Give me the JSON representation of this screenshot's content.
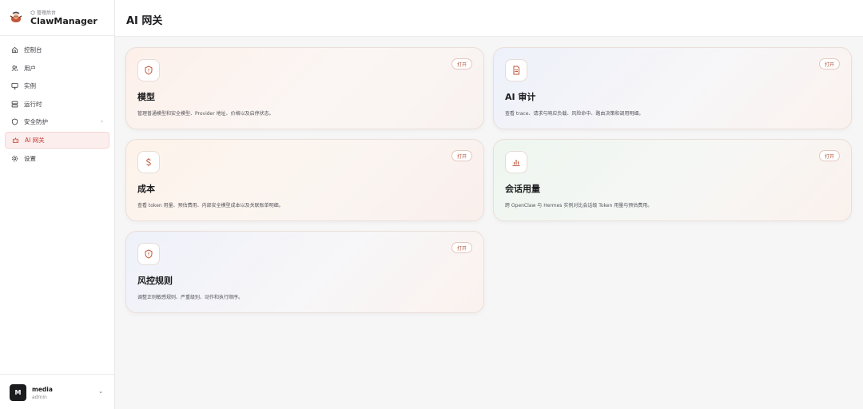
{
  "brand": {
    "subtitle": "管理后台",
    "title": "ClawManager"
  },
  "sidebar": {
    "items": [
      {
        "label": "控制台",
        "icon": "home-icon"
      },
      {
        "label": "用户",
        "icon": "users-icon"
      },
      {
        "label": "实例",
        "icon": "monitor-icon"
      },
      {
        "label": "运行时",
        "icon": "server-icon"
      },
      {
        "label": "安全防护",
        "icon": "shield-icon"
      },
      {
        "label": "AI 网关",
        "icon": "bot-icon",
        "active": true
      },
      {
        "label": "设置",
        "icon": "gear-icon"
      }
    ]
  },
  "user": {
    "initial": "M",
    "name": "media",
    "role": "admin"
  },
  "header": {
    "title": "AI 网关"
  },
  "cards": [
    {
      "title": "模型",
      "desc": "管理普通模型和安全模型、Provider 地址、价格以及启停状态。",
      "button": "打开",
      "icon": "shield-icon"
    },
    {
      "title": "AI 审计",
      "desc": "查看 trace、请求与响应负载、风险命中、路由决策和调用明细。",
      "button": "打开",
      "icon": "file-icon"
    },
    {
      "title": "成本",
      "desc": "查看 token 用量、预估费用、内部安全模型成本以及关联账单明细。",
      "button": "打开",
      "icon": "dollar-icon"
    },
    {
      "title": "会话用量",
      "desc": "跨 OpenClaw 与 Hermes 实例对比会话级 Token 用量与预估费用。",
      "button": "打开",
      "icon": "bar-chart-icon"
    },
    {
      "title": "风控规则",
      "desc": "调整正则敏感规则、严重级别、动作和执行顺序。",
      "button": "打开",
      "icon": "shield-icon"
    }
  ],
  "colors": {
    "accent": "#c0392b",
    "active_bg": "#fdeeee"
  }
}
